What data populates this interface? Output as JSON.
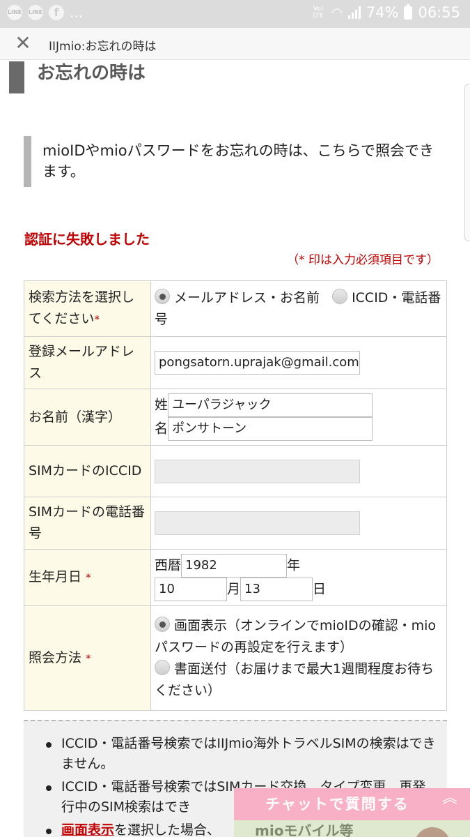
{
  "status_bar": {
    "app_icons": [
      "LINE",
      "LINE",
      "f"
    ],
    "more": "...",
    "network": "Vo) LTE",
    "battery": "74%",
    "time": "06:55"
  },
  "browser": {
    "title": "IIJmio:お忘れの時は"
  },
  "page": {
    "heading": "お忘れの時は",
    "intro": "mioIDやmioパスワードをお忘れの時は、こちらで照会できます。",
    "error": "認証に失敗しました",
    "required_note": "（* 印は入力必須項目です）"
  },
  "form": {
    "search_method": {
      "label": "検索方法を選択してください",
      "required": "*",
      "option_mail": "メールアドレス・お名前",
      "option_iccid": "ICCID・電話番号"
    },
    "email": {
      "label": "登録メールアドレス",
      "value": "pongsatorn.uprajak@gmail.com"
    },
    "name": {
      "label": "お名前（漢字）",
      "family_label": "姓",
      "family_value": "ユーパラジャック",
      "given_label": "名",
      "given_value": "ポンサトーン"
    },
    "iccid": {
      "label": "SIMカードのICCID",
      "value": ""
    },
    "phone": {
      "label": "SIMカードの電話番号",
      "value": ""
    },
    "birth": {
      "label": "生年月日",
      "required": "*",
      "era_label": "西暦",
      "year": "1982",
      "year_unit": "年",
      "month": "10",
      "month_unit": "月",
      "day": "13",
      "day_unit": "日"
    },
    "inquiry": {
      "label": "照会方法",
      "required": "*",
      "option_screen": "画面表示（オンラインでmioIDの確認・mioパスワードの再設定を行えます）",
      "option_mail": "書面送付（お届けまで最大1週間程度お待ちください）"
    }
  },
  "notes": {
    "items": [
      "ICCID・電話番号検索ではIIJmio海外トラベルSIMの検索はできません。",
      "ICCID・電話番号検索ではSIMカード交換、タイプ変更、再発行中のSIM検索はでき",
      "を選択した場合、"
    ],
    "link": "画面表示"
  },
  "chat": {
    "label": "チャットで質問する",
    "chevron": "︽",
    "sub": "mioモバイル等"
  }
}
